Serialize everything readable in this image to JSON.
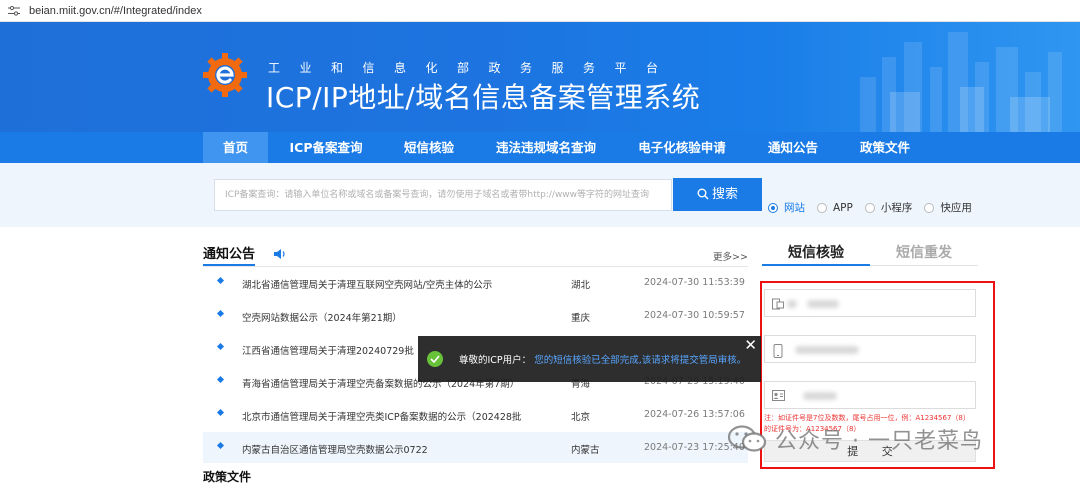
{
  "browser": {
    "url": "beian.miit.gov.cn/#/Integrated/index"
  },
  "banner": {
    "subtitle": "工业和信息化部政务服务平台",
    "title": "ICP/IP地址/域名信息备案管理系统"
  },
  "nav": {
    "items": [
      "首页",
      "ICP备案查询",
      "短信核验",
      "违法违规域名查询",
      "电子化核验申请",
      "通知公告",
      "政策文件"
    ]
  },
  "search": {
    "placeholder": "ICP备案查询：请输入单位名称或域名或备案号查询，请勿使用子域名或者带http://www等字符的网址查询",
    "button_label": "搜索",
    "options": [
      "网站",
      "APP",
      "小程序",
      "快应用"
    ],
    "selected": "网站"
  },
  "notice": {
    "heading": "通知公告",
    "more": "更多>>",
    "rows": [
      {
        "title": "湖北省通信管理局关于清理互联网空壳网站/空壳主体的公示",
        "region": "湖北",
        "date": "2024-07-30 11:53:39"
      },
      {
        "title": "空壳网站数据公示（2024年第21期）",
        "region": "重庆",
        "date": "2024-07-30 10:59:57"
      },
      {
        "title": "江西省通信管理局关于清理20240729批",
        "region": "",
        "date": ""
      },
      {
        "title": "青海省通信管理局关于清理空壳备案数据的公示（2024年第7期）",
        "region": "青海",
        "date": "2024-07-29 15:19:40"
      },
      {
        "title": "北京市通信管理局关于清理空壳类ICP备案数据的公示（202428批",
        "region": "北京",
        "date": "2024-07-26 13:57:06"
      },
      {
        "title": "内蒙古自治区通信管理局空壳数据公示0722",
        "region": "内蒙古",
        "date": "2024-07-23 17:25:40"
      }
    ]
  },
  "policy": {
    "heading": "政策文件"
  },
  "sms": {
    "tab_active": "短信核验",
    "tab_inactive": "短信重发",
    "hint": "注：如证件号是7位及数数，尾号占用一位，例：A1234567（8）的证件号为：A1234567（8）",
    "submit_label": "提 交"
  },
  "toast": {
    "prefix": "尊敬的ICP用户：",
    "message": "您的短信核验已全部完成,该请求将提交管局审核。",
    "close": "✕"
  },
  "watermark": {
    "text": "公众号 · 一只老菜鸟"
  },
  "colors": {
    "primary": "#1a7be6",
    "highlight_border": "#e11111",
    "success": "#67c23a"
  }
}
